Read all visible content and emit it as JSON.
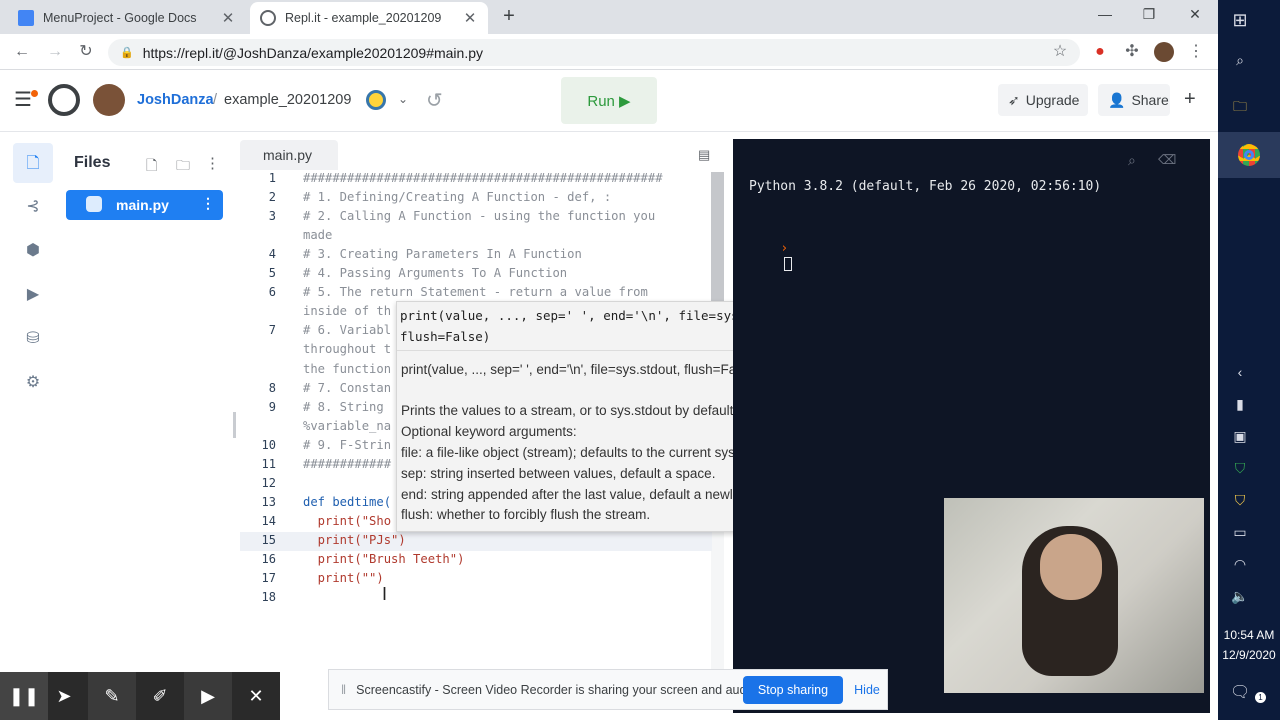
{
  "browser": {
    "tabs": [
      {
        "title": "MenuProject - Google Docs",
        "icon": "google-docs-icon",
        "active": false
      },
      {
        "title": "Repl.it - example_20201209",
        "icon": "replit-icon",
        "active": true
      }
    ],
    "new_tab": "+",
    "url": "https://repl.it/@JoshDanza/example20201209#main.py"
  },
  "app": {
    "username": "JoshDanza",
    "separator": "/",
    "project": "example_20201209",
    "run_label": "Run ▶",
    "upgrade_label": "Upgrade",
    "share_label": "Share",
    "plus": "+"
  },
  "files": {
    "title": "Files",
    "items": [
      {
        "name": "main.py"
      }
    ]
  },
  "editor": {
    "tab": "main.py",
    "lines": [
      {
        "n": "1",
        "text": "#################################################",
        "cls": "cmt"
      },
      {
        "n": "2",
        "text": "# 1. Defining/Creating A Function - def, :",
        "cls": "cmt"
      },
      {
        "n": "3",
        "text": "# 2. Calling A Function - using the function you",
        "cls": "cmt"
      },
      {
        "n": "",
        "text": "made",
        "cls": "cmt"
      },
      {
        "n": "4",
        "text": "# 3. Creating Parameters In A Function",
        "cls": "cmt"
      },
      {
        "n": "5",
        "text": "# 4. Passing Arguments To A Function",
        "cls": "cmt"
      },
      {
        "n": "6",
        "text": "# 5. The return Statement - return a value from",
        "cls": "cmt"
      },
      {
        "n": "",
        "text": "inside of th",
        "cls": "cmt"
      },
      {
        "n": "7",
        "text": "# 6. Variabl",
        "cls": "cmt"
      },
      {
        "n": "",
        "text": "throughout t",
        "cls": "cmt"
      },
      {
        "n": "",
        "text": "the function",
        "cls": "cmt"
      },
      {
        "n": "8",
        "text": "# 7. Constan",
        "cls": "cmt"
      },
      {
        "n": "9",
        "text": "# 8. String",
        "cls": "cmt"
      },
      {
        "n": "",
        "text": "%variable_na",
        "cls": "cmt"
      },
      {
        "n": "10",
        "text": "# 9. F-Strin",
        "cls": "cmt"
      },
      {
        "n": "11",
        "text": "############",
        "cls": "cmt"
      },
      {
        "n": "12",
        "text": "",
        "cls": ""
      },
      {
        "n": "13",
        "text": "def bedtime(",
        "cls": "kw"
      },
      {
        "n": "14",
        "text": "  print(\"Sho",
        "cls": "str"
      },
      {
        "n": "15",
        "text": "  print(\"PJs\")",
        "cls": "str"
      },
      {
        "n": "16",
        "text": "  print(\"Brush Teeth\")",
        "cls": "str"
      },
      {
        "n": "17",
        "text": "  print(\"\")",
        "cls": "str"
      },
      {
        "n": "18",
        "text": "",
        "cls": ""
      }
    ]
  },
  "tooltip": {
    "sig1": "print(value, ..., sep=' ', end='\\n', file=sys.stdout,",
    "sig2": "flush=False)",
    "plain": "print(value, ..., sep=' ', end='\\n', file=sys.stdout, flush=False)",
    "doc": [
      "Prints the values to a stream, or to sys.stdout by default.",
      "Optional keyword arguments:",
      "file:  a file-like object (stream); defaults to the current sys.stdout.",
      "sep:   string inserted between values, default a space.",
      "end:   string appended after the last value, default a newline.",
      "flush: whether to forcibly flush the stream."
    ]
  },
  "console": {
    "banner": "Python 3.8.2 (default, Feb 26 2020, 02:56:10)",
    "prompt": "›"
  },
  "screencastify": {
    "message": "Screencastify - Screen Video Recorder is sharing your screen and audio.",
    "stop_label": "Stop sharing",
    "hide_label": "Hide"
  },
  "taskbar": {
    "time": "10:54 AM",
    "date": "12/9/2020",
    "notifications": "1"
  },
  "colors": {
    "accent": "#1f7ff2",
    "run": "#2d9a3d",
    "console_bg": "#0e1525"
  }
}
